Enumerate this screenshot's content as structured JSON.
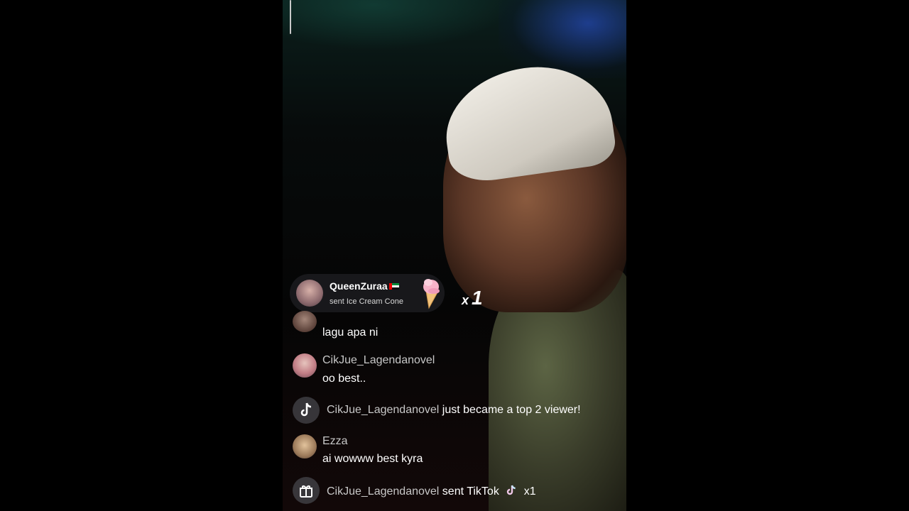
{
  "gift_banner": {
    "username": "QueenZuraa",
    "action": "sent Ice Cream Cone",
    "icon": "ice-cream-cone-icon",
    "count_prefix": "x",
    "count": "1"
  },
  "comments": [
    {
      "kind": "comment",
      "username": "",
      "message": "lagu apa ni"
    },
    {
      "kind": "comment",
      "username": "CikJue_Lagendanovel",
      "message": "oo best.."
    },
    {
      "kind": "system",
      "icon": "tiktok-logo-icon",
      "username": "CikJue_Lagendanovel",
      "text": "just became a top 2 viewer!"
    },
    {
      "kind": "comment",
      "username": "Ezza",
      "message": "ai wowww best kyra"
    },
    {
      "kind": "system",
      "icon": "gift-icon",
      "username": "CikJue_Lagendanovel",
      "text": "sent TikTok",
      "suffix": "x1"
    }
  ],
  "colors": {
    "username": "#c7c7c7",
    "message": "#ffffff",
    "banner_bg": "rgba(40,40,45,0.55)"
  }
}
